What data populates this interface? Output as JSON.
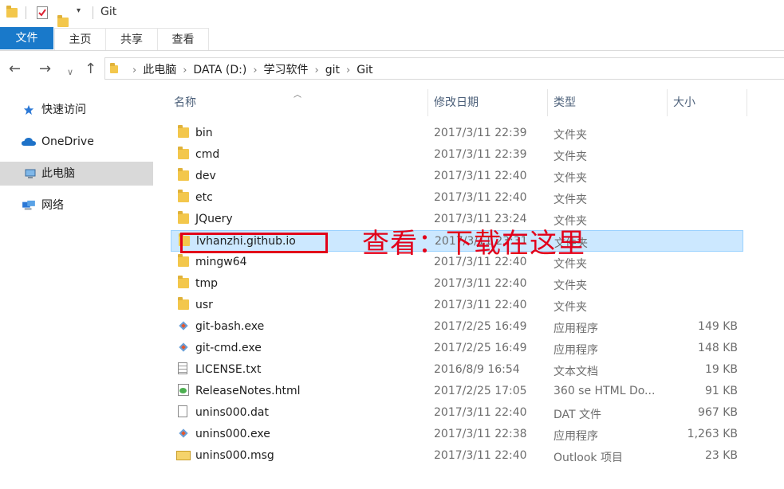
{
  "window": {
    "title": "Git"
  },
  "ribbon": {
    "tabs": [
      {
        "label": "文件"
      },
      {
        "label": "主页"
      },
      {
        "label": "共享"
      },
      {
        "label": "查看"
      }
    ]
  },
  "nav": {
    "back_glyph": "←",
    "forward_glyph": "→",
    "recent_glyph": "∨",
    "up_glyph": "↑",
    "breadcrumbs": [
      "此电脑",
      "DATA (D:)",
      "学习软件",
      "git",
      "Git"
    ]
  },
  "sidebar": {
    "items": [
      {
        "label": "快速访问",
        "icon": "star-icon"
      },
      {
        "label": "OneDrive",
        "icon": "cloud-icon"
      },
      {
        "label": "此电脑",
        "icon": "computer-icon"
      },
      {
        "label": "网络",
        "icon": "network-icon"
      }
    ]
  },
  "columns": {
    "name": "名称",
    "date": "修改日期",
    "type": "类型",
    "size": "大小"
  },
  "files": [
    {
      "name": "bin",
      "date": "2017/3/11 22:39",
      "type": "文件夹",
      "size": "",
      "icon": "folder-icon"
    },
    {
      "name": "cmd",
      "date": "2017/3/11 22:39",
      "type": "文件夹",
      "size": "",
      "icon": "folder-icon"
    },
    {
      "name": "dev",
      "date": "2017/3/11 22:40",
      "type": "文件夹",
      "size": "",
      "icon": "folder-icon"
    },
    {
      "name": "etc",
      "date": "2017/3/11 22:40",
      "type": "文件夹",
      "size": "",
      "icon": "folder-icon"
    },
    {
      "name": "JQuery",
      "date": "2017/3/11 23:24",
      "type": "文件夹",
      "size": "",
      "icon": "folder-icon"
    },
    {
      "name": "lvhanzhi.github.io",
      "date": "2017/3/11 23:31",
      "type": "文件夹",
      "size": "",
      "icon": "folder-icon"
    },
    {
      "name": "mingw64",
      "date": "2017/3/11 22:40",
      "type": "文件夹",
      "size": "",
      "icon": "folder-icon"
    },
    {
      "name": "tmp",
      "date": "2017/3/11 22:40",
      "type": "文件夹",
      "size": "",
      "icon": "folder-icon"
    },
    {
      "name": "usr",
      "date": "2017/3/11 22:40",
      "type": "文件夹",
      "size": "",
      "icon": "folder-icon"
    },
    {
      "name": "git-bash.exe",
      "date": "2017/2/25 16:49",
      "type": "应用程序",
      "size": "149 KB",
      "icon": "git-icon"
    },
    {
      "name": "git-cmd.exe",
      "date": "2017/2/25 16:49",
      "type": "应用程序",
      "size": "148 KB",
      "icon": "git-icon"
    },
    {
      "name": "LICENSE.txt",
      "date": "2016/8/9 16:54",
      "type": "文本文档",
      "size": "19 KB",
      "icon": "text-file-icon"
    },
    {
      "name": "ReleaseNotes.html",
      "date": "2017/2/25 17:05",
      "type": "360 se HTML Do...",
      "size": "91 KB",
      "icon": "html-file-icon"
    },
    {
      "name": "unins000.dat",
      "date": "2017/3/11 22:40",
      "type": "DAT 文件",
      "size": "967 KB",
      "icon": "blank-file-icon"
    },
    {
      "name": "unins000.exe",
      "date": "2017/3/11 22:38",
      "type": "应用程序",
      "size": "1,263 KB",
      "icon": "git-icon"
    },
    {
      "name": "unins000.msg",
      "date": "2017/3/11 22:40",
      "type": "Outlook 项目",
      "size": "23 KB",
      "icon": "mail-icon"
    }
  ],
  "annotation": {
    "text": "查看：下载在这里"
  },
  "colors": {
    "accent": "#1979ca",
    "selection": "#cce8ff",
    "annotation": "#e2001a"
  }
}
